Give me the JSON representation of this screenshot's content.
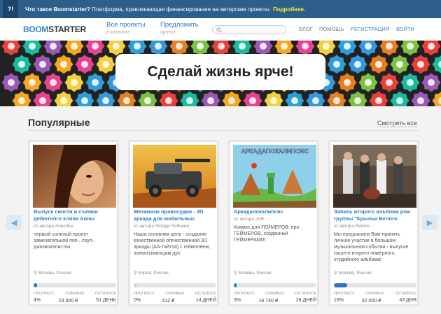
{
  "infobar": {
    "icon": "?!",
    "question": "Что такое Boomstarter?",
    "text": " Платформа, привлекающая финансирование на авторские проекты.",
    "more": "Подробнее."
  },
  "header": {
    "logo_a": "BOOM",
    "logo_b": "STARTER",
    "nav": [
      {
        "label": "Все проекты",
        "sub": "в каталоге"
      },
      {
        "label": "Предложить",
        "sub": "проект"
      }
    ],
    "search_placeholder": "",
    "links": [
      "БЛОГ",
      "ПОМОЩЬ",
      "РЕГИСТРАЦИЯ",
      "ВОЙТИ"
    ]
  },
  "banner": {
    "slogan": "Сделай жизнь ярче!"
  },
  "popular": {
    "title": "Популярные",
    "see_all": "Смотреть все"
  },
  "colors": {
    "accent": "#2b77bd",
    "infobar": "#2d5f8b",
    "progress": "#2e74c0"
  },
  "cards": [
    {
      "title": "Выпуск сингла и съемки дебютного клипа Анны",
      "author": "от автора Aneshka",
      "desc": "первый сольный проект замечательной поп-, соул-, джазвокалистки",
      "location": "Москва, Россия",
      "progress": 4,
      "labels": [
        "ПРОГРЕСС",
        "СОБРАНО",
        "ОСТАЛОСЬ"
      ],
      "values": [
        "4%",
        "23 300 ₽",
        "51 ДЕНЬ"
      ]
    },
    {
      "title": "Механизм правосудия - 3D аркада для мобильных",
      "author": "от автора SinApp Software",
      "desc": "Наша основная цель - создание качественной отечественной 3D аркады (AA-тайтла) с геймплеем, захватывающим дух.",
      "location": "Киров, Россия",
      "progress": 0,
      "labels": [
        "ПРОГРЕСС",
        "СОБРАНО",
        "ОСТАЛОСЬ"
      ],
      "values": [
        "0%",
        "412 ₽",
        "14 ДНЕЙ"
      ]
    },
    {
      "title": "Аркадапокалипсис",
      "author": "от автора JAR",
      "desc": "Комикс для ГЕЙМЕРОВ, про ГЕЙМЕРОВ, созданный ГЕЙМЕРАМИ!",
      "location": "Москва, Россия",
      "progress": 3,
      "labels": [
        "ПРОГРЕСС",
        "СОБРАНО",
        "ОСТАЛОСЬ"
      ],
      "values": [
        "3%",
        "16 740 ₽",
        "28 ДНЕЙ"
      ],
      "image_text": "АРКАДАПОКАЛИПСИС"
    },
    {
      "title": "Запись второго альбома рок-группы \"Крылья Белого",
      "author": "от автора Rubets",
      "desc": "Мы предлагаем Вам принять личное участие в большом музыкальном событии - выпуске нашего второго номерного, студийного альбома!",
      "location": "Москва, Россия",
      "progress": 16,
      "labels": [
        "ПРОГРЕСС",
        "СОБРАНО",
        "ОСТАЛОСЬ"
      ],
      "values": [
        "16%",
        "32 000 ₽",
        "43 ДНЯ"
      ]
    }
  ]
}
